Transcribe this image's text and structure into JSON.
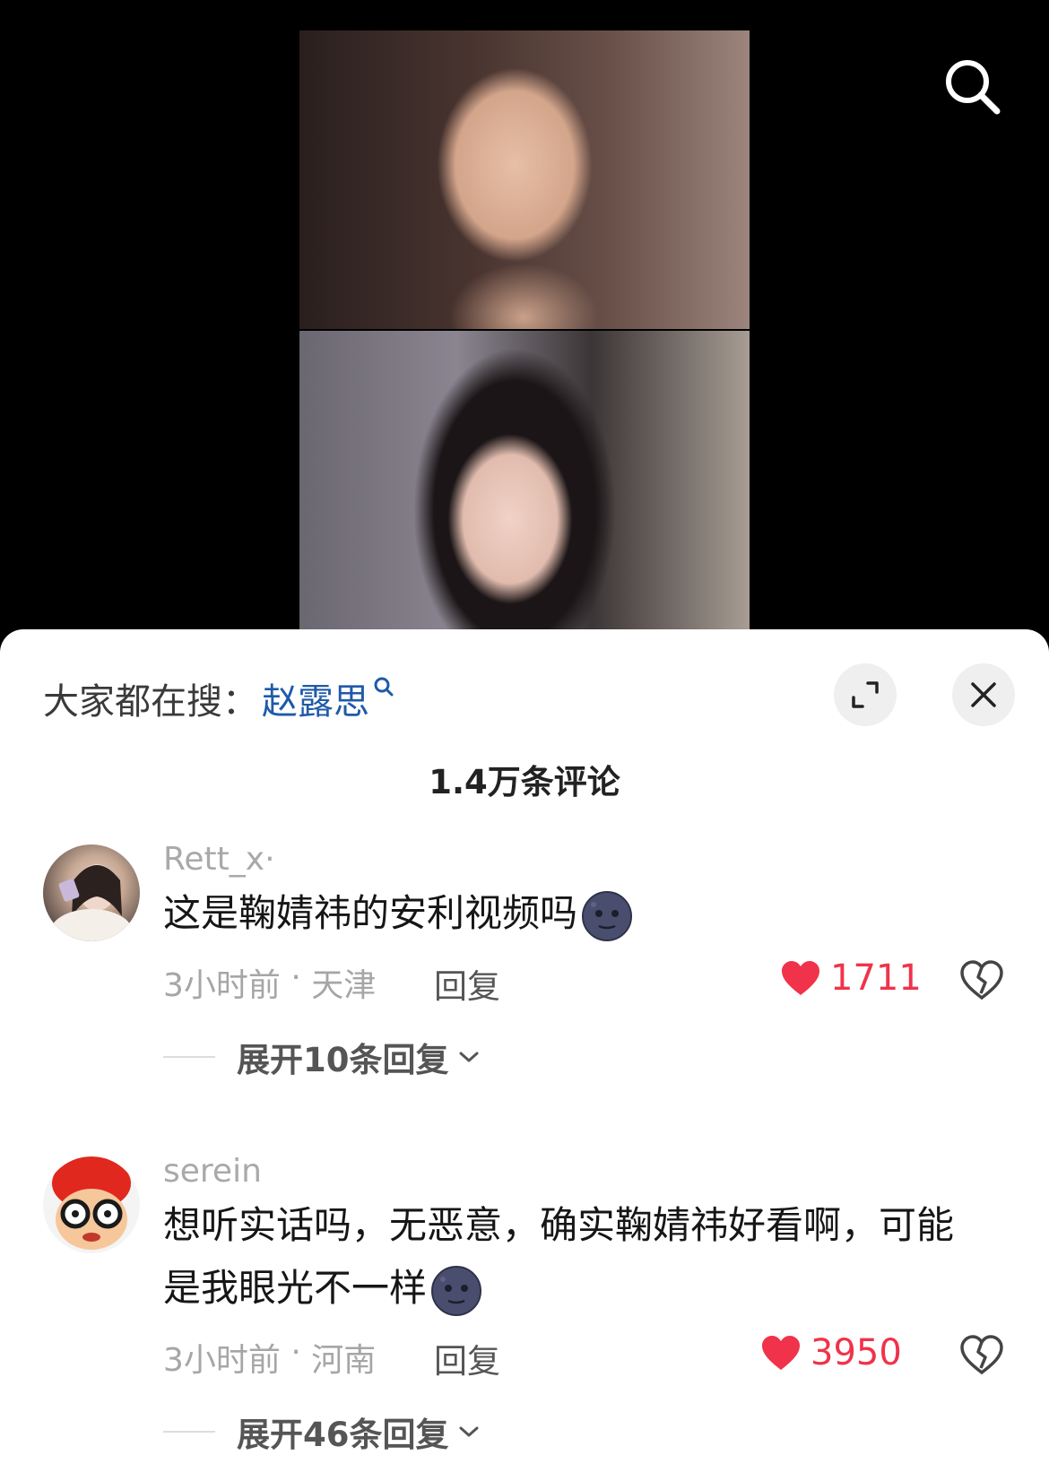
{
  "hot_search": {
    "prefix": "大家都在搜：",
    "keyword": "赵露思"
  },
  "comment_count": "1.4万条评论",
  "comments": [
    {
      "username": "Rett_x·",
      "text": "这是鞠婧祎的安利视频吗",
      "time": "3小时前",
      "sep": " · ",
      "location": "天津",
      "reply": "回复",
      "likes": "1711",
      "expand": "展开10条回复"
    },
    {
      "username": "serein",
      "text_line1": "想听实话吗，无恶意，确实鞠婧祎好看啊，可能",
      "text_line2": "是我眼光不一样",
      "time": "3小时前",
      "sep": " · ",
      "location": "河南",
      "reply": "回复",
      "likes": "3950",
      "expand": "展开46条回复"
    }
  ],
  "colors": {
    "like": "#f0334a",
    "keyword": "#1f5aa8",
    "sheet": "#ffffff"
  },
  "icons": [
    "search-icon",
    "expand-icon",
    "close-icon",
    "heart-icon",
    "dislike-heart-icon",
    "chevron-down-icon",
    "moon-emoji-icon"
  ]
}
